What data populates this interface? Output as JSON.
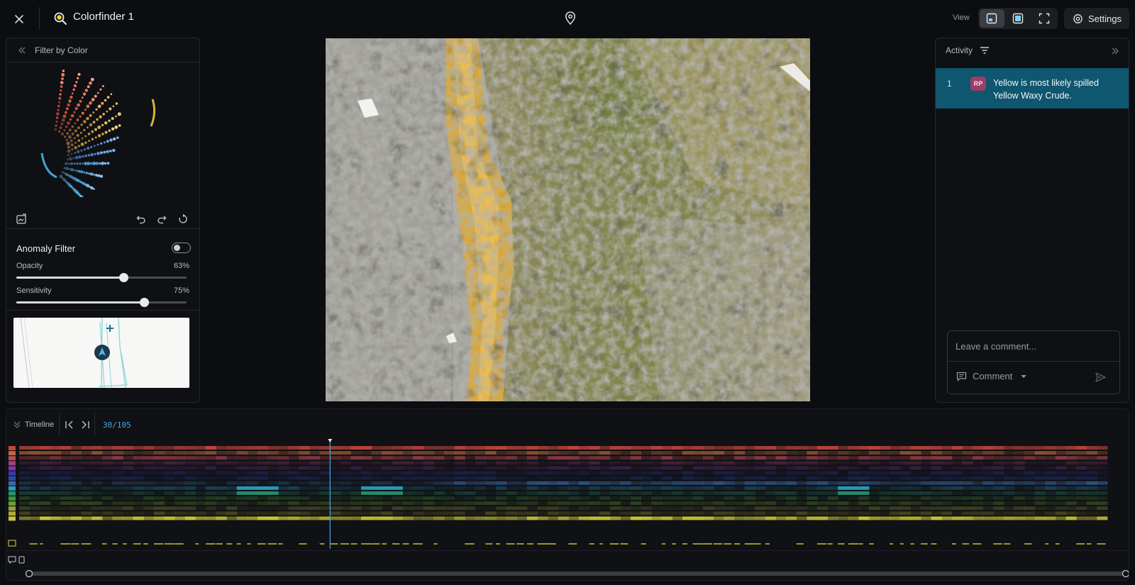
{
  "app": {
    "title": "Colorfinder 1"
  },
  "header": {
    "view_label": "View",
    "settings_label": "Settings"
  },
  "left_panel": {
    "title": "Filter by Color",
    "anomaly": {
      "title": "Anomaly Filter",
      "enabled": false,
      "sliders": [
        {
          "label": "Opacity",
          "value": 63,
          "display": "63%"
        },
        {
          "label": "Sensitivity",
          "value": 75,
          "display": "75%"
        }
      ]
    }
  },
  "activity": {
    "title": "Activity",
    "items": [
      {
        "index": "1",
        "initials": "RP",
        "text": "Yellow is most likely spilled Yellow Waxy Crude."
      }
    ],
    "comment_placeholder": "Leave a comment...",
    "comment_type": "Comment"
  },
  "timeline": {
    "title": "Timeline",
    "current_frame": 30,
    "total_frames": 105,
    "frame_display": "30/105"
  },
  "colors": {
    "accent": "#45a8e8",
    "activity_highlight": "#0f566f",
    "avatar": "#9a3e68",
    "background": "#0c0d10"
  }
}
